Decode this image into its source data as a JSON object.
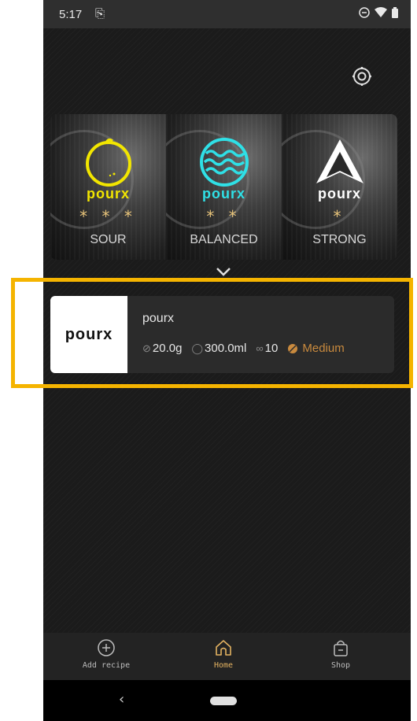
{
  "status_bar": {
    "time": "5:17",
    "sim_icon": "sim-card-icon",
    "icons": [
      "do-not-disturb-icon",
      "wifi-icon",
      "battery-icon"
    ]
  },
  "header": {
    "settings_icon": "settings-icon"
  },
  "flavor_cards": [
    {
      "brand": "pourx",
      "stars": "* * *",
      "label": "SOUR",
      "icon": "lemon-icon",
      "color": "#f2e600"
    },
    {
      "brand": "pourx",
      "stars": "* *",
      "label": "BALANCED",
      "icon": "waves-icon",
      "color": "#2fe0e6"
    },
    {
      "brand": "pourx",
      "stars": "*",
      "label": "STRONG",
      "icon": "triangle-icon",
      "color": "#ffffff"
    }
  ],
  "recipe": {
    "thumb_text": "pourx",
    "name": "pourx",
    "dose": "20.0g",
    "water": "300.0ml",
    "ratio": "10",
    "roast": "Medium"
  },
  "bottom_nav": {
    "items": [
      {
        "label": "Add recipe",
        "icon": "plus-circle-icon",
        "active": false
      },
      {
        "label": "Home",
        "icon": "home-icon",
        "active": true
      },
      {
        "label": "Shop",
        "icon": "shopping-bag-icon",
        "active": false
      }
    ]
  },
  "colors": {
    "accent": "#e3b261",
    "highlight": "#f5b400",
    "roast": "#c98a3e"
  }
}
